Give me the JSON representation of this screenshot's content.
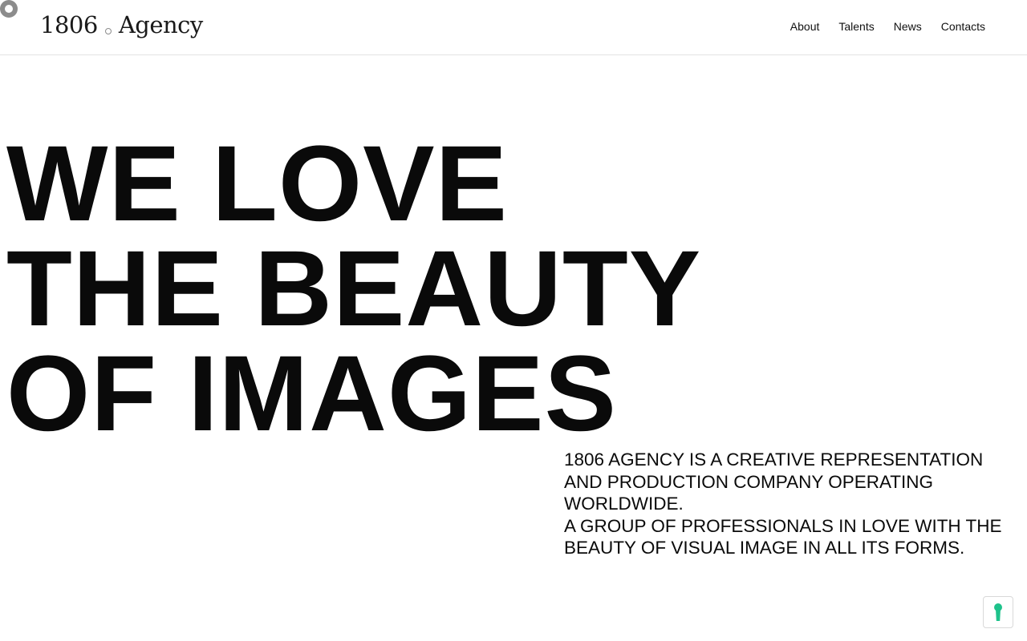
{
  "header": {
    "logo": {
      "number": "1806",
      "word": "Agency"
    },
    "nav": {
      "items": [
        {
          "label": "About"
        },
        {
          "label": "Talents"
        },
        {
          "label": "News"
        },
        {
          "label": "Contacts"
        }
      ]
    }
  },
  "hero": {
    "lines": [
      "WE LOVE",
      "THE BEAUTY",
      "OF IMAGES"
    ]
  },
  "description": {
    "paragraph_1": "1806 AGENCY IS A CREATIVE REPRESENTATION AND PRODUCTION COMPANY OPERATING WORLDWIDE.",
    "paragraph_2": "A GROUP OF PROFESSIONALS IN LOVE WITH THE BEAUTY OF VISUAL IMAGE IN ALL ITS FORMS."
  },
  "widgets": {
    "privacy_icon": "keyhole-icon"
  },
  "colors": {
    "text": "#0a0a0a",
    "accent_privacy": "#1ec28b",
    "logo_dot": "#8c8c8c"
  }
}
